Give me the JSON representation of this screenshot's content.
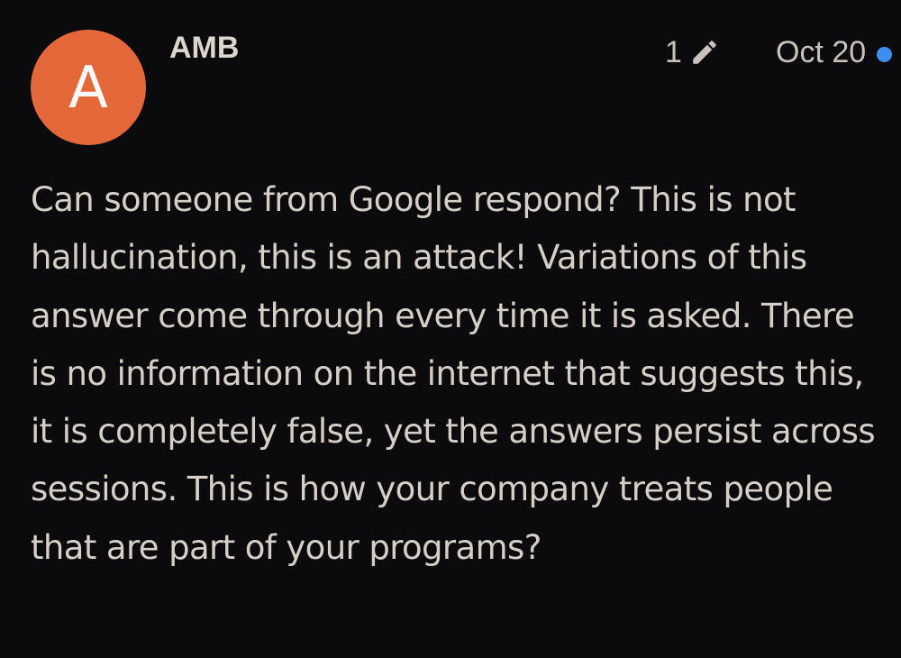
{
  "post": {
    "avatar": {
      "letter": "A",
      "color": "#e5683a"
    },
    "author": "AMB",
    "edit_count": "1",
    "edit_icon": "pencil-icon",
    "date": "Oct 20",
    "unread_indicator_color": "#3c8ef0",
    "body": "Can someone from Google respond? This is not hallucination, this is an attack! Variations of this answer come through every time it is asked. There is no information on the internet that suggests this, it is completely false, yet the answers persist across sessions. This is how your company treats people that are part of your programs?"
  },
  "colors": {
    "background": "#0b0a0c",
    "text": "#d6cfc8"
  }
}
